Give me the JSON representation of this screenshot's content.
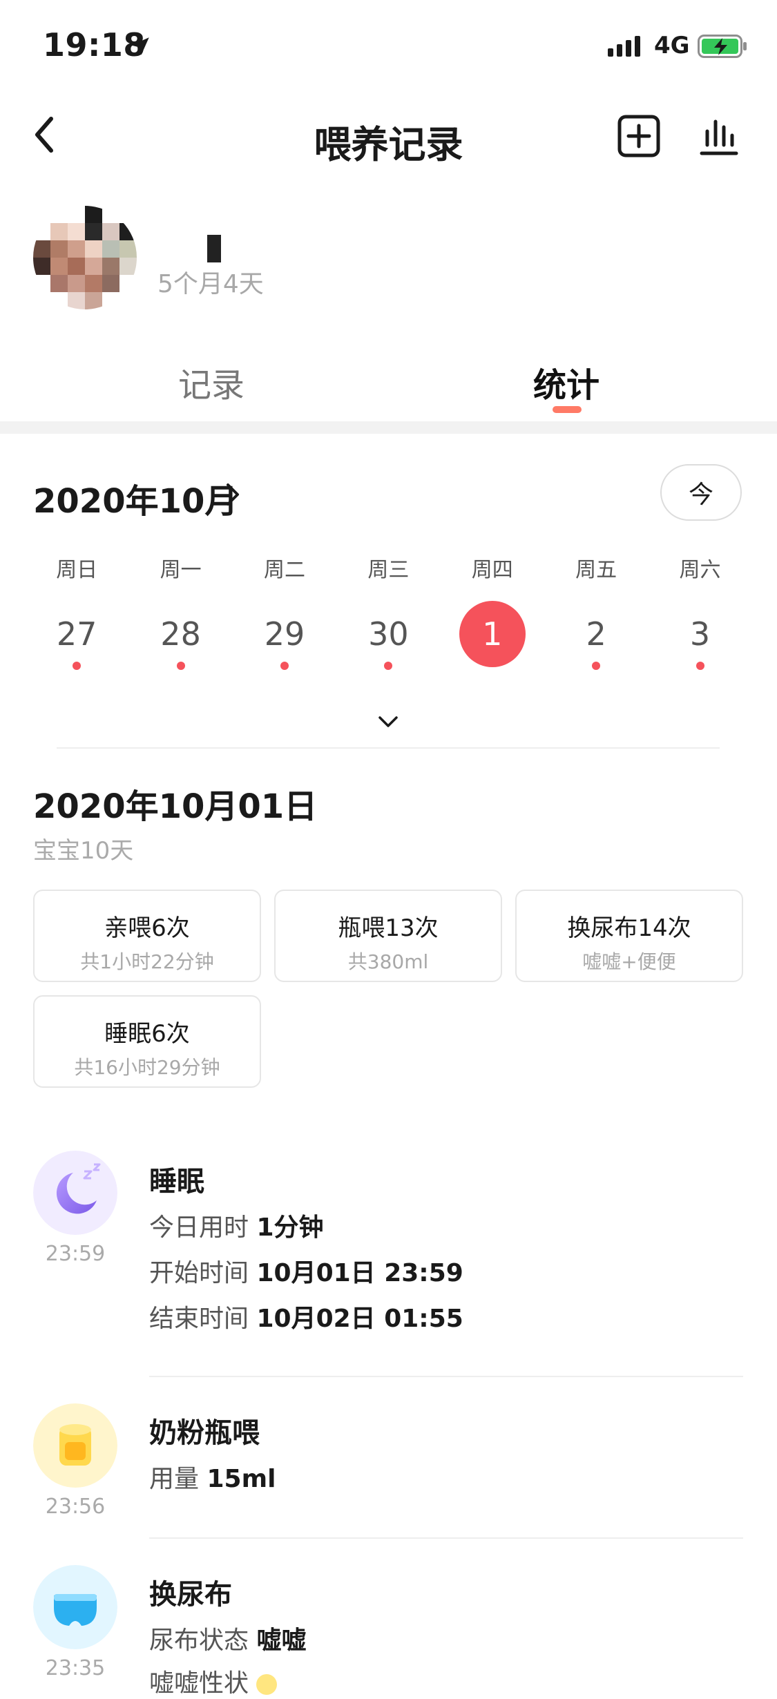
{
  "status_bar": {
    "time": "19:18",
    "network": "4G",
    "location_icon": "location-arrow-icon",
    "signal_icon": "signal-bars-icon",
    "battery_icon": "battery-charging-icon",
    "battery_color": "#34c759"
  },
  "header": {
    "title": "喂养记录",
    "back_icon": "chevron-left-icon",
    "add_icon": "plus-square-icon",
    "stats_icon": "bar-chart-icon"
  },
  "baby": {
    "age": "5个月4天"
  },
  "tabs": [
    {
      "label": "记录",
      "active": false
    },
    {
      "label": "统计",
      "active": true
    }
  ],
  "calendar": {
    "month_label": "2020年10月",
    "today_label": "今",
    "weekdays": [
      "周日",
      "周一",
      "周二",
      "周三",
      "周四",
      "周五",
      "周六"
    ],
    "days": [
      {
        "label": "27",
        "has_record": true,
        "selected": false
      },
      {
        "label": "28",
        "has_record": true,
        "selected": false
      },
      {
        "label": "29",
        "has_record": true,
        "selected": false
      },
      {
        "label": "30",
        "has_record": true,
        "selected": false
      },
      {
        "label": "1",
        "has_record": false,
        "selected": true
      },
      {
        "label": "2",
        "has_record": true,
        "selected": false
      },
      {
        "label": "3",
        "has_record": true,
        "selected": false
      }
    ],
    "accent_color": "#f5525b"
  },
  "day_summary": {
    "date": "2020年10月01日",
    "baby_age": "宝宝10天",
    "cards": [
      {
        "title": "亲喂6次",
        "sub": "共1小时22分钟"
      },
      {
        "title": "瓶喂13次",
        "sub": "共380ml"
      },
      {
        "title": "换尿布14次",
        "sub": "嘘嘘+便便"
      },
      {
        "title": "睡眠6次",
        "sub": "共16小时29分钟"
      }
    ]
  },
  "timeline": [
    {
      "icon": "moon-sleep-icon",
      "time": "23:59",
      "title": "睡眠",
      "lines": [
        {
          "label": "今日用时",
          "value": "1分钟"
        },
        {
          "label": "开始时间",
          "value": "10月01日 23:59"
        },
        {
          "label": "结束时间",
          "value": "10月02日 01:55"
        }
      ]
    },
    {
      "icon": "formula-bottle-icon",
      "time": "23:56",
      "title": "奶粉瓶喂",
      "lines": [
        {
          "label": "用量",
          "value": "15ml"
        }
      ]
    },
    {
      "icon": "diaper-icon",
      "time": "23:35",
      "title": "换尿布",
      "lines": [
        {
          "label": "尿布状态",
          "value": "嘘嘘"
        },
        {
          "label": "嘘嘘性状",
          "value": ""
        }
      ]
    }
  ]
}
